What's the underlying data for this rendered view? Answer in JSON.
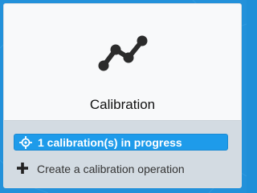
{
  "card": {
    "title": "Calibration",
    "icon": "calibration-graph-icon"
  },
  "status": {
    "progress_label": "1 calibration(s) in progress",
    "progress_icon": "crosshair-icon"
  },
  "actions": {
    "create_label": "Create a calibration operation",
    "create_icon": "plus-icon"
  },
  "colors": {
    "accent": "#1e9bea",
    "background": "#2391da",
    "card": "#f8f9fa",
    "footer": "#d3dbe2"
  }
}
